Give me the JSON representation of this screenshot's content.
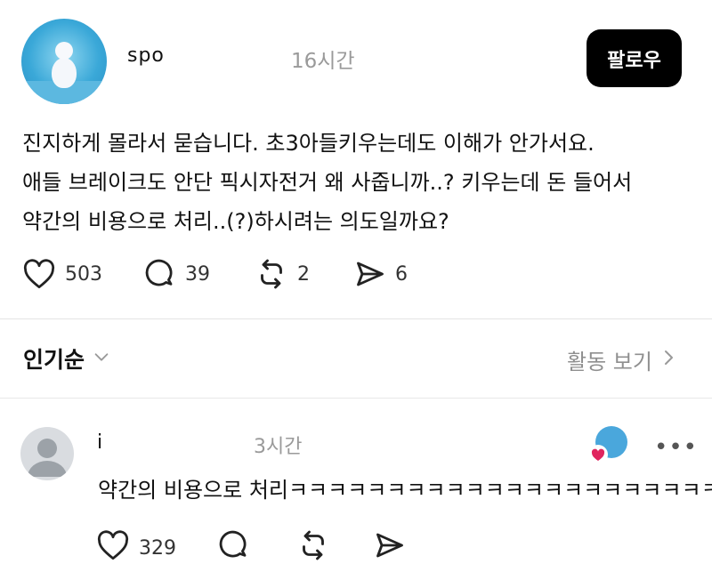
{
  "post": {
    "author": {
      "username": "spo",
      "time": "16시간"
    },
    "follow_label": "팔로우",
    "text_lines": [
      "진지하게 몰라서 묻습니다. 초3아들키우는데도 이해가 안가서요.",
      "애들 브레이크도 안단 픽시자전거 왜 사줍니까..? 키우는데 돈 들어서",
      "약간의 비용으로 처리..(?)하시려는 의도일까요?"
    ],
    "stats": {
      "likes": "503",
      "comments": "39",
      "reposts": "2",
      "shares": "6"
    }
  },
  "replies_header": {
    "sort_label": "인기순",
    "activity_label": "활동 보기"
  },
  "comments": [
    {
      "username": "i",
      "time": "3시간",
      "text": "약간의 비용으로 처리ㅋㅋㅋㅋㅋㅋㅋㅋㅋㅋㅋㅋㅋㅋㅋㅋㅋㅋㅋㅋㅋㅋ",
      "likes": "329"
    }
  ],
  "icons": [
    "heart-icon",
    "comment-icon",
    "repost-icon",
    "share-icon",
    "chevron-down-icon",
    "chevron-right-icon",
    "more-icon"
  ],
  "colors": {
    "follow_bg": "#000000",
    "follow_text": "#ffffff",
    "secondary_text": "#9a9a9a",
    "liked_heart": "#e0245e"
  }
}
